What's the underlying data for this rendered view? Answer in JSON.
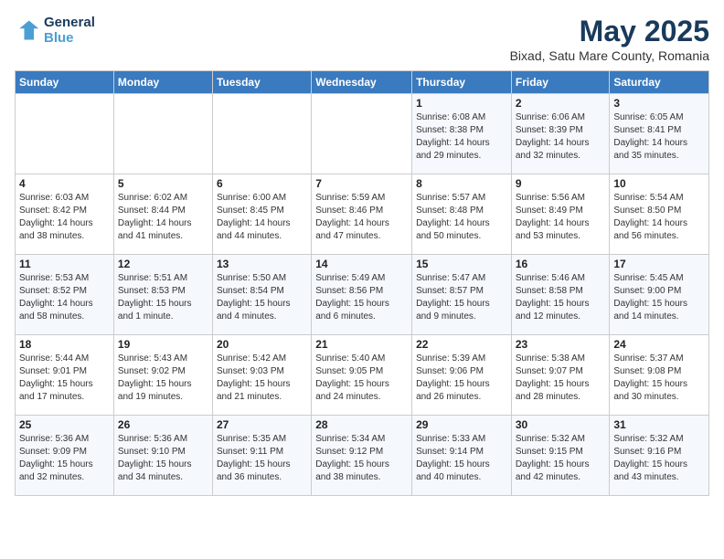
{
  "logo": {
    "line1": "General",
    "line2": "Blue"
  },
  "title": "May 2025",
  "location": "Bixad, Satu Mare County, Romania",
  "days_of_week": [
    "Sunday",
    "Monday",
    "Tuesday",
    "Wednesday",
    "Thursday",
    "Friday",
    "Saturday"
  ],
  "weeks": [
    [
      {
        "day": "",
        "info": ""
      },
      {
        "day": "",
        "info": ""
      },
      {
        "day": "",
        "info": ""
      },
      {
        "day": "",
        "info": ""
      },
      {
        "day": "1",
        "info": "Sunrise: 6:08 AM\nSunset: 8:38 PM\nDaylight: 14 hours\nand 29 minutes."
      },
      {
        "day": "2",
        "info": "Sunrise: 6:06 AM\nSunset: 8:39 PM\nDaylight: 14 hours\nand 32 minutes."
      },
      {
        "day": "3",
        "info": "Sunrise: 6:05 AM\nSunset: 8:41 PM\nDaylight: 14 hours\nand 35 minutes."
      }
    ],
    [
      {
        "day": "4",
        "info": "Sunrise: 6:03 AM\nSunset: 8:42 PM\nDaylight: 14 hours\nand 38 minutes."
      },
      {
        "day": "5",
        "info": "Sunrise: 6:02 AM\nSunset: 8:44 PM\nDaylight: 14 hours\nand 41 minutes."
      },
      {
        "day": "6",
        "info": "Sunrise: 6:00 AM\nSunset: 8:45 PM\nDaylight: 14 hours\nand 44 minutes."
      },
      {
        "day": "7",
        "info": "Sunrise: 5:59 AM\nSunset: 8:46 PM\nDaylight: 14 hours\nand 47 minutes."
      },
      {
        "day": "8",
        "info": "Sunrise: 5:57 AM\nSunset: 8:48 PM\nDaylight: 14 hours\nand 50 minutes."
      },
      {
        "day": "9",
        "info": "Sunrise: 5:56 AM\nSunset: 8:49 PM\nDaylight: 14 hours\nand 53 minutes."
      },
      {
        "day": "10",
        "info": "Sunrise: 5:54 AM\nSunset: 8:50 PM\nDaylight: 14 hours\nand 56 minutes."
      }
    ],
    [
      {
        "day": "11",
        "info": "Sunrise: 5:53 AM\nSunset: 8:52 PM\nDaylight: 14 hours\nand 58 minutes."
      },
      {
        "day": "12",
        "info": "Sunrise: 5:51 AM\nSunset: 8:53 PM\nDaylight: 15 hours\nand 1 minute."
      },
      {
        "day": "13",
        "info": "Sunrise: 5:50 AM\nSunset: 8:54 PM\nDaylight: 15 hours\nand 4 minutes."
      },
      {
        "day": "14",
        "info": "Sunrise: 5:49 AM\nSunset: 8:56 PM\nDaylight: 15 hours\nand 6 minutes."
      },
      {
        "day": "15",
        "info": "Sunrise: 5:47 AM\nSunset: 8:57 PM\nDaylight: 15 hours\nand 9 minutes."
      },
      {
        "day": "16",
        "info": "Sunrise: 5:46 AM\nSunset: 8:58 PM\nDaylight: 15 hours\nand 12 minutes."
      },
      {
        "day": "17",
        "info": "Sunrise: 5:45 AM\nSunset: 9:00 PM\nDaylight: 15 hours\nand 14 minutes."
      }
    ],
    [
      {
        "day": "18",
        "info": "Sunrise: 5:44 AM\nSunset: 9:01 PM\nDaylight: 15 hours\nand 17 minutes."
      },
      {
        "day": "19",
        "info": "Sunrise: 5:43 AM\nSunset: 9:02 PM\nDaylight: 15 hours\nand 19 minutes."
      },
      {
        "day": "20",
        "info": "Sunrise: 5:42 AM\nSunset: 9:03 PM\nDaylight: 15 hours\nand 21 minutes."
      },
      {
        "day": "21",
        "info": "Sunrise: 5:40 AM\nSunset: 9:05 PM\nDaylight: 15 hours\nand 24 minutes."
      },
      {
        "day": "22",
        "info": "Sunrise: 5:39 AM\nSunset: 9:06 PM\nDaylight: 15 hours\nand 26 minutes."
      },
      {
        "day": "23",
        "info": "Sunrise: 5:38 AM\nSunset: 9:07 PM\nDaylight: 15 hours\nand 28 minutes."
      },
      {
        "day": "24",
        "info": "Sunrise: 5:37 AM\nSunset: 9:08 PM\nDaylight: 15 hours\nand 30 minutes."
      }
    ],
    [
      {
        "day": "25",
        "info": "Sunrise: 5:36 AM\nSunset: 9:09 PM\nDaylight: 15 hours\nand 32 minutes."
      },
      {
        "day": "26",
        "info": "Sunrise: 5:36 AM\nSunset: 9:10 PM\nDaylight: 15 hours\nand 34 minutes."
      },
      {
        "day": "27",
        "info": "Sunrise: 5:35 AM\nSunset: 9:11 PM\nDaylight: 15 hours\nand 36 minutes."
      },
      {
        "day": "28",
        "info": "Sunrise: 5:34 AM\nSunset: 9:12 PM\nDaylight: 15 hours\nand 38 minutes."
      },
      {
        "day": "29",
        "info": "Sunrise: 5:33 AM\nSunset: 9:14 PM\nDaylight: 15 hours\nand 40 minutes."
      },
      {
        "day": "30",
        "info": "Sunrise: 5:32 AM\nSunset: 9:15 PM\nDaylight: 15 hours\nand 42 minutes."
      },
      {
        "day": "31",
        "info": "Sunrise: 5:32 AM\nSunset: 9:16 PM\nDaylight: 15 hours\nand 43 minutes."
      }
    ]
  ]
}
